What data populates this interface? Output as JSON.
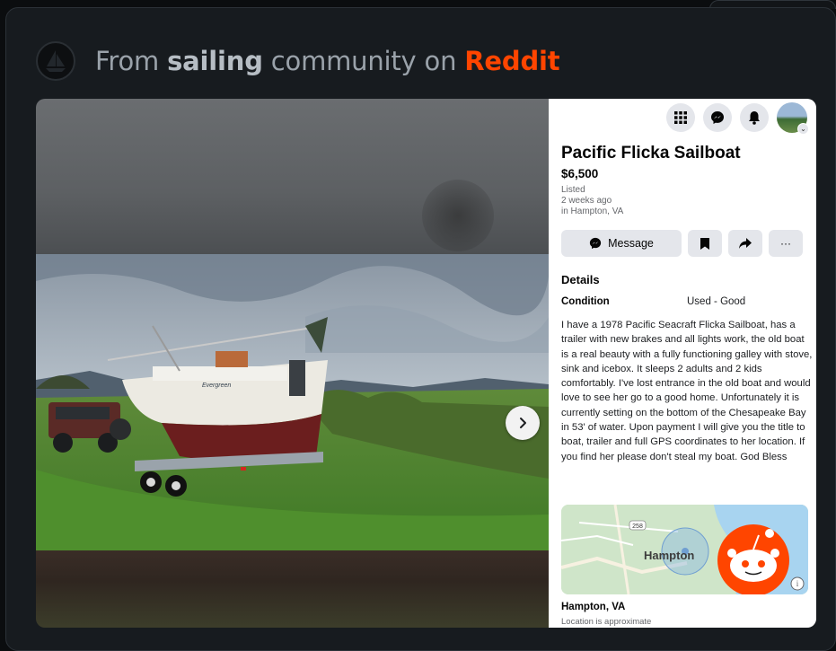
{
  "header": {
    "prefix": "From",
    "community": "sailing",
    "middle": "community on",
    "platform": "Reddit",
    "platform_color": "#ff4500"
  },
  "listing": {
    "title": "Pacific Flicka Sailboat",
    "price": "$6,500",
    "listed_label": "Listed",
    "listed_when": "2 weeks ago",
    "listed_where": "in Hampton, VA",
    "message_label": "Message",
    "more_label": "···",
    "details_heading": "Details",
    "condition_label": "Condition",
    "condition_value": "Used - Good",
    "description": "I have a 1978 Pacific Seacraft Flicka Sailboat, has a trailer with new brakes and all lights work, the old boat is a real beauty with a fully functioning galley with stove, sink and icebox. It sleeps 2 adults and 2 kids comfortably. I've lost entrance in the old boat and would love to see her go to a good home. Unfortunately it is currently setting on the bottom of the Chesapeake Bay in 53' of water. Upon payment I will give you the title to boat, trailer and full GPS coordinates to her location.   If you find her please don't  steal my boat.     God Bless",
    "map_city_label": "Hampton",
    "map_route_label": "258",
    "location": "Hampton, VA",
    "location_note": "Location is approximate"
  },
  "photo": {
    "boat_name": "Evergreen"
  },
  "icons": {
    "community_avatar": "sailboat-icon",
    "topbar": [
      "apps-grid-icon",
      "messenger-icon",
      "bell-icon",
      "profile-avatar"
    ],
    "actions": [
      "messenger-icon",
      "bookmark-icon",
      "share-icon",
      "more-icon"
    ],
    "next": "chevron-right-icon",
    "reddit_mascot": "snoo-icon"
  }
}
